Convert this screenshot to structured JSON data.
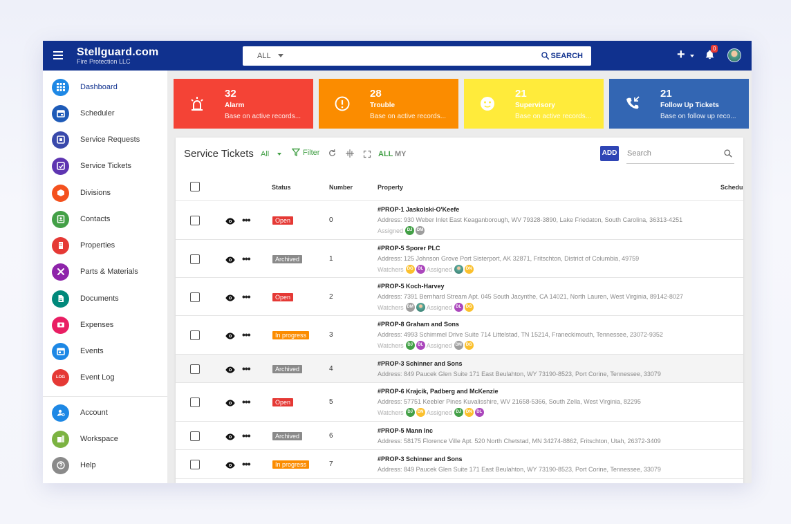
{
  "header": {
    "brand_name": "Stellguard.com",
    "brand_sub": "Fire Protection LLC",
    "search_scope": "ALL",
    "search_button": "SEARCH",
    "add_label": "+",
    "notifications_count": "0"
  },
  "sidebar": {
    "items": [
      {
        "label": "Dashboard",
        "icon": "grid-icon",
        "color": "#1e88e5"
      },
      {
        "label": "Scheduler",
        "icon": "calendar-icon",
        "color": "#1e5bb8"
      },
      {
        "label": "Service Requests",
        "icon": "request-icon",
        "color": "#3949ab"
      },
      {
        "label": "Service Tickets",
        "icon": "ticket-icon",
        "color": "#5e35b1"
      },
      {
        "label": "Divisions",
        "icon": "box-icon",
        "color": "#f4511e"
      },
      {
        "label": "Contacts",
        "icon": "contact-icon",
        "color": "#43a047"
      },
      {
        "label": "Properties",
        "icon": "building-icon",
        "color": "#e53935"
      },
      {
        "label": "Parts & Materials",
        "icon": "tools-icon",
        "color": "#8e24aa"
      },
      {
        "label": "Documents",
        "icon": "document-icon",
        "color": "#00897b"
      },
      {
        "label": "Expenses",
        "icon": "money-icon",
        "color": "#e91e63"
      },
      {
        "label": "Events",
        "icon": "event-icon",
        "color": "#1e88e5"
      },
      {
        "label": "Event Log",
        "icon": "log-icon",
        "color": "#e53935",
        "glyph": "LOG"
      }
    ],
    "bottom_items": [
      {
        "label": "Account",
        "icon": "account-icon",
        "color": "#1e88e5"
      },
      {
        "label": "Workspace",
        "icon": "workspace-icon",
        "color": "#7cb342"
      },
      {
        "label": "Help",
        "icon": "help-icon",
        "color": "#8a8a8a"
      }
    ]
  },
  "cards": [
    {
      "count": "32",
      "title": "Alarm",
      "sub": "Base on active records...",
      "color": "#f44336",
      "icon": "alarm-icon"
    },
    {
      "count": "28",
      "title": "Trouble",
      "sub": "Base on active records...",
      "color": "#fb8c00",
      "icon": "alert-circle-icon"
    },
    {
      "count": "21",
      "title": "Supervisory",
      "sub": "Base on active records...",
      "color": "#ffeb3b",
      "icon": "face-icon"
    },
    {
      "count": "21",
      "title": "Follow Up Tickets",
      "sub": "Base on follow up reco...",
      "color": "#3366b3",
      "icon": "phone-callback-icon"
    }
  ],
  "tickets": {
    "title": "Service Tickets",
    "filter_scope": "All",
    "filter_label": "Filter",
    "scope_all": "ALL",
    "scope_my": "MY",
    "add_label": "ADD",
    "search_placeholder": "Search",
    "columns": {
      "status": "Status",
      "number": "Number",
      "property": "Property",
      "schedule": "Schedul"
    },
    "rows": [
      {
        "status": "Open",
        "number": "0",
        "property": "#PROP-1 Jaskolski-O'Keefe",
        "address": "Address: 930 Weber Inlet East Keaganborough, WV 79328-3890, Lake Friedaton, South Carolina, 36313-4251",
        "watchers_label": "",
        "watchers": [],
        "assigned_label": "Assigned",
        "assigned": [
          {
            "t": "DJ",
            "c": "#43a047"
          },
          {
            "t": "DM",
            "c": "#9e9e9e"
          }
        ]
      },
      {
        "status": "Archived",
        "number": "1",
        "property": "#PROP-5 Sporer PLC",
        "address": "Address: 125 Johnson Grove Port Sisterport, AK 32871, Fritschton, District of Columbia, 49759",
        "watchers_label": "Watchers",
        "watchers": [
          {
            "t": "DG",
            "c": "#fbc02d"
          },
          {
            "t": "DL",
            "c": "#ab47bc"
          }
        ],
        "assigned_label": "Assigned",
        "assigned": [
          {
            "t": "",
            "c": "photo"
          },
          {
            "t": "DN",
            "c": "#fbc02d"
          }
        ]
      },
      {
        "status": "Open",
        "number": "2",
        "property": "#PROP-5 Koch-Harvey",
        "address": "Address: 7391 Bernhard Stream Apt. 045 South Jacynthe, CA 14021, North Lauren, West Virginia, 89142-8027",
        "watchers_label": "Watchers",
        "watchers": [
          {
            "t": "DM",
            "c": "#9e9e9e"
          },
          {
            "t": "",
            "c": "photo"
          }
        ],
        "assigned_label": "Assigned",
        "assigned": [
          {
            "t": "DL",
            "c": "#ab47bc"
          },
          {
            "t": "DG",
            "c": "#fbc02d"
          }
        ]
      },
      {
        "status": "In progress",
        "number": "3",
        "property": "#PROP-8 Graham and Sons",
        "address": "Address: 4993 Schimmel Drive Suite 714 Littelstad, TN 15214, Franeckimouth, Tennessee, 23072-9352",
        "watchers_label": "Watchers",
        "watchers": [
          {
            "t": "DJ",
            "c": "#43a047"
          },
          {
            "t": "DL",
            "c": "#ab47bc"
          }
        ],
        "assigned_label": "Assigned",
        "assigned": [
          {
            "t": "DM",
            "c": "#9e9e9e"
          },
          {
            "t": "DG",
            "c": "#fbc02d"
          }
        ]
      },
      {
        "status": "Archived",
        "number": "4",
        "property": "#PROP-3 Schinner and Sons",
        "address": "Address: 849 Paucek Glen Suite 171 East Beulahton, WY 73190-8523, Port Corine, Tennessee, 33079",
        "watchers_label": "",
        "watchers": [],
        "assigned_label": "",
        "assigned": []
      },
      {
        "status": "Open",
        "number": "5",
        "property": "#PROP-6 Krajcik, Padberg and McKenzie",
        "address": "Address: 57751 Keebler Pines Kuvalisshire, WV 21658-5366, South Zella, West Virginia, 82295",
        "watchers_label": "Watchers",
        "watchers": [
          {
            "t": "DJ",
            "c": "#43a047"
          },
          {
            "t": "DN",
            "c": "#fbc02d"
          }
        ],
        "assigned_label": "Assigned",
        "assigned": [
          {
            "t": "DJ",
            "c": "#43a047"
          },
          {
            "t": "DN",
            "c": "#fbc02d"
          },
          {
            "t": "DL",
            "c": "#ab47bc"
          }
        ]
      },
      {
        "status": "Archived",
        "number": "6",
        "property": "#PROP-5 Mann Inc",
        "address": "Address: 58175 Florence Ville Apt. 520 North Chetstad, MN 34274-8862, Fritschton, Utah, 26372-3409",
        "watchers_label": "",
        "watchers": [],
        "assigned_label": "",
        "assigned": []
      },
      {
        "status": "In progress",
        "number": "7",
        "property": "#PROP-3 Schinner and Sons",
        "address": "Address: 849 Paucek Glen Suite 171 East Beulahton, WY 73190-8523, Port Corine, Tennessee, 33079",
        "watchers_label": "",
        "watchers": [],
        "assigned_label": "",
        "assigned": []
      }
    ]
  }
}
